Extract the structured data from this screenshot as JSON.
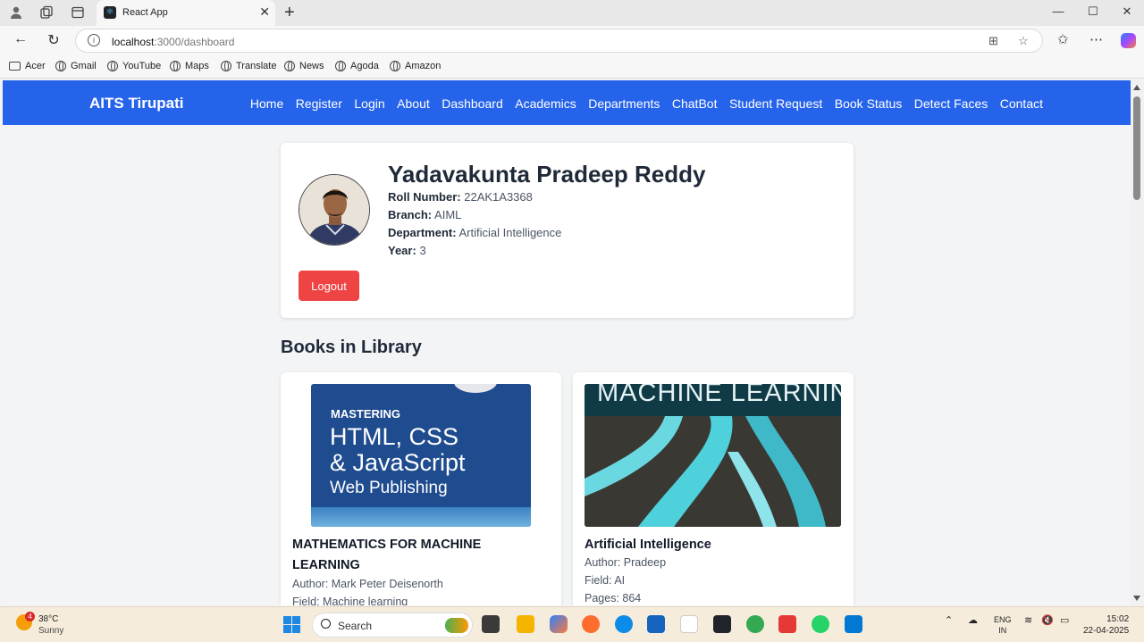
{
  "browser": {
    "tab_title": "React App",
    "url_host": "localhost",
    "url_rest": ":3000/dashboard",
    "bookmarks": [
      "Acer",
      "Gmail",
      "YouTube",
      "Maps",
      "Translate",
      "News",
      "Agoda",
      "Amazon"
    ]
  },
  "navbar": {
    "brand": "AITS Tirupati",
    "links": [
      "Home",
      "Register",
      "Login",
      "About",
      "Dashboard",
      "Academics",
      "Departments",
      "ChatBot",
      "Student Request",
      "Book Status",
      "Detect Faces",
      "Contact"
    ],
    "color": "#2563eb"
  },
  "profile": {
    "name": "Yadavakunta Pradeep Reddy",
    "roll_label": "Roll Number:",
    "roll": "22AK1A3368",
    "branch_label": "Branch:",
    "branch": "AIML",
    "department_label": "Department:",
    "department": "Artificial Intelligence",
    "year_label": "Year:",
    "year": "3",
    "logout": "Logout",
    "logout_color": "#ef4444"
  },
  "library": {
    "title": "Books in Library",
    "books": [
      {
        "cover_line1": "MASTERING",
        "cover_line2": "HTML, CSS",
        "cover_line3": "& JavaScript",
        "cover_line4": "Web Publishing",
        "title": "MATHEMATICS FOR MACHINE LEARNING",
        "author": "Author: Mark Peter Deisenorth",
        "field": "Field: Machine learning"
      },
      {
        "cover_line1": "MACHINE LEARNING",
        "title": "Artificial Intelligence",
        "author": "Author: Pradeep",
        "field": "Field: AI",
        "pages": "Pages: 864"
      }
    ]
  },
  "taskbar": {
    "weather_badge": "4",
    "temperature": "38°C",
    "condition": "Sunny",
    "search": "Search",
    "lang_top": "ENG",
    "lang_bottom": "IN",
    "time": "15:02",
    "date": "22-04-2025"
  }
}
